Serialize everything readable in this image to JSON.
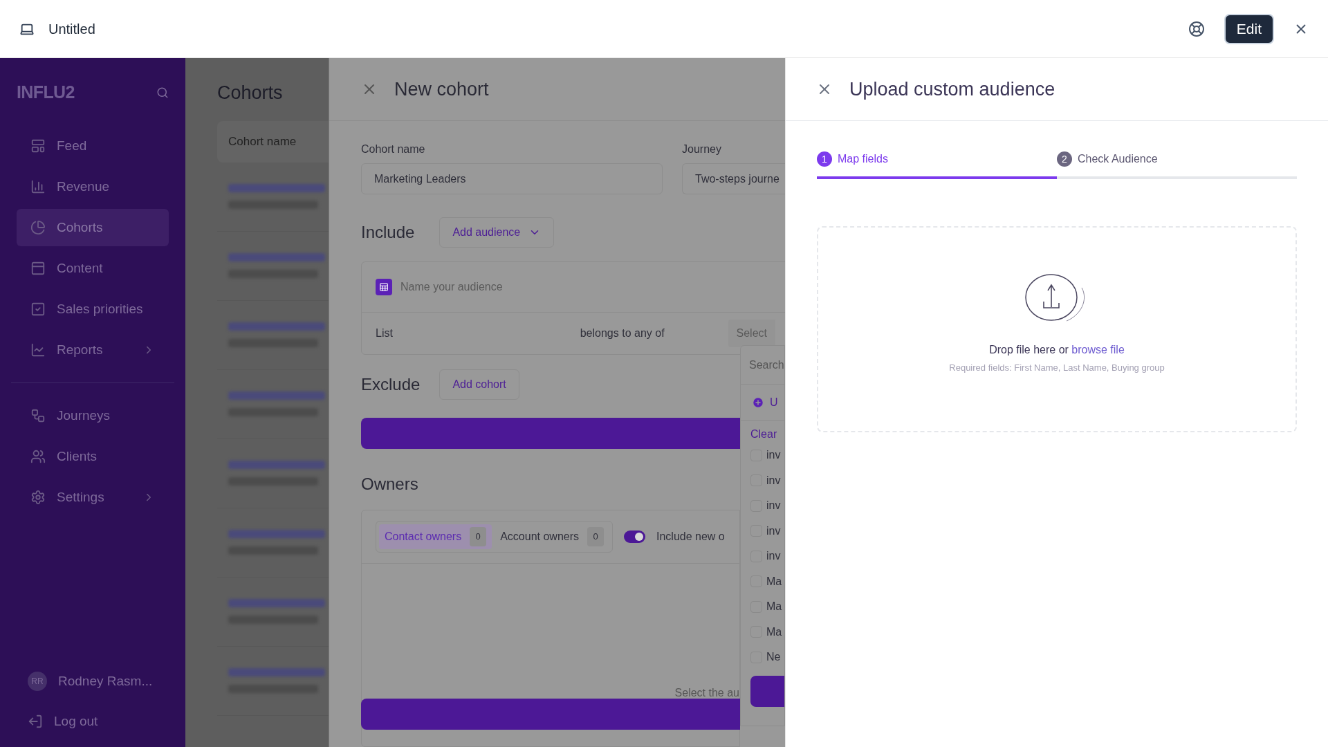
{
  "window": {
    "title": "Untitled",
    "edit_button": "Edit"
  },
  "sidebar": {
    "logo": "INFLU2",
    "items": [
      {
        "label": "Feed",
        "selected": false,
        "submenu": false
      },
      {
        "label": "Revenue",
        "selected": false,
        "submenu": false
      },
      {
        "label": "Cohorts",
        "selected": true,
        "submenu": false
      },
      {
        "label": "Content",
        "selected": false,
        "submenu": false
      },
      {
        "label": "Sales priorities",
        "selected": false,
        "submenu": false
      },
      {
        "label": "Reports",
        "selected": false,
        "submenu": true
      }
    ],
    "secondary_items": [
      {
        "label": "Journeys",
        "selected": false,
        "submenu": false
      },
      {
        "label": "Clients",
        "selected": false,
        "submenu": false
      },
      {
        "label": "Settings",
        "selected": false,
        "submenu": true
      }
    ],
    "user": {
      "initials": "RR",
      "name": "Rodney Rasm..."
    },
    "logout": "Log out"
  },
  "cohorts_list": {
    "title": "Cohorts",
    "column": "Cohort name"
  },
  "new_cohort": {
    "title": "New cohort",
    "cohort_name": {
      "label": "Cohort name",
      "value": "Marketing Leaders"
    },
    "journey": {
      "label": "Journey",
      "value": "Two-steps journe"
    },
    "include": {
      "title": "Include",
      "button": "Add audience",
      "audience_placeholder": "Name your audience",
      "rule": {
        "field": "List",
        "operator": "belongs to any of",
        "value_placeholder": "Select"
      }
    },
    "exclude": {
      "title": "Exclude",
      "button": "Add cohort"
    },
    "owners": {
      "title": "Owners",
      "tabs": [
        {
          "label": "Contact owners",
          "count": "0",
          "selected": true
        },
        {
          "label": "Account owners",
          "count": "0",
          "selected": false
        }
      ],
      "include_new": {
        "label": "Include new o",
        "on": true
      },
      "hint": "Select the au"
    },
    "dropdown": {
      "search_placeholder": "Search",
      "upload": "U",
      "clear": "Clear",
      "options": [
        {
          "label": "inv",
          "checked": false
        },
        {
          "label": "inv",
          "checked": false
        },
        {
          "label": "inv",
          "checked": false
        },
        {
          "label": "inv",
          "checked": false
        },
        {
          "label": "inv",
          "checked": false
        },
        {
          "label": "Ma",
          "checked": false
        },
        {
          "label": "Ma",
          "checked": false
        },
        {
          "label": "Ma",
          "checked": false
        },
        {
          "label": "Ne",
          "checked": false
        }
      ]
    }
  },
  "upload_panel": {
    "title": "Upload custom audience",
    "steps": [
      {
        "number": "1",
        "label": "Map fields",
        "selected": true
      },
      {
        "number": "2",
        "label": "Check Audience",
        "selected": false
      }
    ],
    "dropzone": {
      "text": "Drop file here or",
      "link": "browse file",
      "required": "Required fields: First Name, Last Name, Buying group"
    }
  }
}
